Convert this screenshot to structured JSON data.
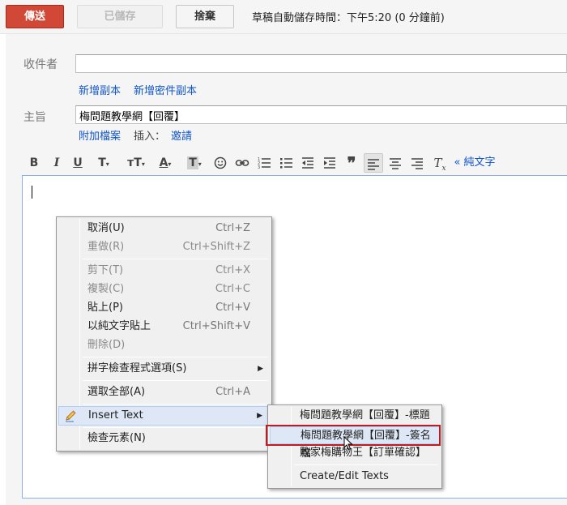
{
  "top_bar": {
    "send": "傳送",
    "saved": "已儲存",
    "discard": "捨棄",
    "autosave_status": "草稿自動儲存時間：下午5:20 (0 分鐘前)"
  },
  "recipients": {
    "label": "收件者",
    "value": "",
    "add_cc": "新增副本",
    "add_bcc": "新增密件副本"
  },
  "subject": {
    "label": "主旨",
    "value": "梅問題教學網【回覆】"
  },
  "attach": {
    "attach_file": "附加檔案",
    "insert_label": "插入：",
    "invitation": "邀請"
  },
  "toolbar": {
    "bold": "B",
    "italic": "I",
    "underline": "U",
    "font": "T",
    "size": "тT",
    "text_color": "A",
    "bg_color": "T",
    "plain_text": "« 純文字"
  },
  "context_menu": {
    "items": [
      {
        "label": "取消(U)",
        "shortcut": "Ctrl+Z"
      },
      {
        "label": "重做(R)",
        "shortcut": "Ctrl+Shift+Z"
      },
      {
        "label": "剪下(T)",
        "shortcut": "Ctrl+X"
      },
      {
        "label": "複製(C)",
        "shortcut": "Ctrl+C"
      },
      {
        "label": "貼上(P)",
        "shortcut": "Ctrl+V"
      },
      {
        "label": "以純文字貼上",
        "shortcut": "Ctrl+Shift+V"
      },
      {
        "label": "刪除(D)",
        "shortcut": ""
      },
      {
        "label": "拼字檢查程式選項(S)",
        "shortcut": ""
      },
      {
        "label": "選取全部(A)",
        "shortcut": "Ctrl+A"
      },
      {
        "label": "Insert Text",
        "shortcut": ""
      },
      {
        "label": "檢查元素(N)",
        "shortcut": ""
      }
    ]
  },
  "submenu": {
    "items": [
      {
        "label": "梅問題教學網【回覆】-標題"
      },
      {
        "label": "梅問題教學網【回覆】-簽名檔"
      },
      {
        "label": "敗家梅購物王【訂單確認】"
      },
      {
        "label": "Create/Edit Texts"
      }
    ]
  },
  "colors": {
    "send_button": "#d14836",
    "link": "#1155cc",
    "highlight_border": "#c21a20",
    "menu_hover": "#dde7f5"
  },
  "icons": [
    "pencil-icon",
    "submenu-arrow-icon",
    "mouse-cursor-icon",
    "emoji-icon",
    "link-icon",
    "numbered-list-icon",
    "bulleted-list-icon",
    "indent-less-icon",
    "indent-more-icon",
    "quote-icon",
    "align-left-icon",
    "align-center-icon",
    "align-right-icon",
    "remove-formatting-icon"
  ]
}
